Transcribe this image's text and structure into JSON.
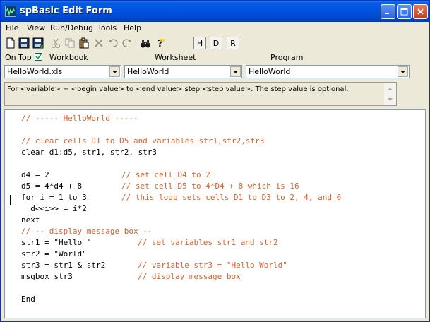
{
  "window": {
    "title": "spBasic Edit Form"
  },
  "menu": [
    "File",
    "View",
    "Run/Debug",
    "Tools",
    "Help"
  ],
  "toolbar": {
    "h_label": "H",
    "d_label": "D",
    "r_label": "R"
  },
  "options": {
    "on_top_label": "On Top",
    "on_top_checked": true,
    "workbook_label": "Workbook",
    "worksheet_label": "Worksheet",
    "program_label": "Program"
  },
  "selectors": {
    "workbook_value": "HelloWorld.xls",
    "worksheet_value": "HelloWorld",
    "program_value": "HelloWorld"
  },
  "help_text": "For <variable> = <begin value> to <end value> step <step value>. The step value is optional.",
  "code": {
    "l1": "// ----- HelloWorld -----",
    "l3": "// clear cells D1 to D5 and variables str1,str2,str3",
    "l4": "clear d1:d5, str1, str2, str3",
    "l6": "d4 = 2",
    "l6c": "// set cell D4 to 2",
    "l7": "d5 = 4*d4 + 8",
    "l7c": "// set cell D5 to 4*D4 + 8 which is 16",
    "l8": "for i = 1 to 3",
    "l8c": "// this loop sets cells D1 to D3 to 2, 4, and 6",
    "l9": "  d<<i>> = i*2",
    "l10": "next",
    "l11": "// -- display message box --",
    "l12": "str1 = \"Hello \"",
    "l12c": "// set variables str1 and str2",
    "l13": "str2 = \"World\"",
    "l14": "str3 = str1 & str2",
    "l14c": "// variable str3 = \"Hello World\"",
    "l15": "msgbox str3",
    "l15c": "// display message box",
    "l17": "End"
  }
}
